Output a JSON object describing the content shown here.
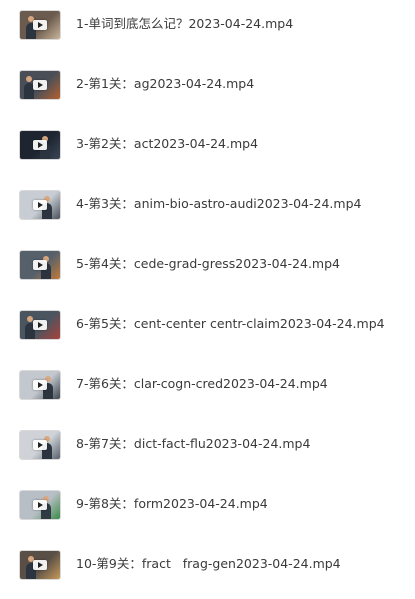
{
  "files": [
    {
      "name": "1-单词到底怎么记？2023-04-24.mp4",
      "thumb_bg": "#6b5a4e",
      "thumb_accent": "#c9b59a",
      "thumb_icon": "video-thumbnail"
    },
    {
      "name": "2-第1关：ag2023-04-24.mp4",
      "thumb_bg": "#4a4f57",
      "thumb_accent": "#b3602f",
      "thumb_icon": "video-thumbnail"
    },
    {
      "name": "3-第2关：act2023-04-24.mp4",
      "thumb_bg": "#1e2530",
      "thumb_accent": "#3b4656",
      "thumb_icon": "video-thumbnail"
    },
    {
      "name": "4-第3关：anim-bio-astro-audi2023-04-24.mp4",
      "thumb_bg": "#c8cdd3",
      "thumb_accent": "#4a525c",
      "thumb_icon": "video-thumbnail"
    },
    {
      "name": "5-第4关：cede-grad-gress2023-04-24.mp4",
      "thumb_bg": "#56606b",
      "thumb_accent": "#c07a3a",
      "thumb_icon": "video-thumbnail"
    },
    {
      "name": "6-第5关：cent-center centr-claim2023-04-24.mp4",
      "thumb_bg": "#4b5560",
      "thumb_accent": "#a9413a",
      "thumb_icon": "video-thumbnail"
    },
    {
      "name": "7-第6关：clar-cogn-cred2023-04-24.mp4",
      "thumb_bg": "#c3c8ce",
      "thumb_accent": "#3f4750",
      "thumb_icon": "video-thumbnail"
    },
    {
      "name": "8-第7关：dict-fact-flu2023-04-24.mp4",
      "thumb_bg": "#cfd3d8",
      "thumb_accent": "#59626d",
      "thumb_icon": "video-thumbnail"
    },
    {
      "name": "9-第8关：form2023-04-24.mp4",
      "thumb_bg": "#b8bec5",
      "thumb_accent": "#3d8b4a",
      "thumb_icon": "video-thumbnail"
    },
    {
      "name": "10-第9关：fract   frag-gen2023-04-24.mp4",
      "thumb_bg": "#5a4f46",
      "thumb_accent": "#c69a5a",
      "thumb_icon": "video-thumbnail"
    }
  ]
}
